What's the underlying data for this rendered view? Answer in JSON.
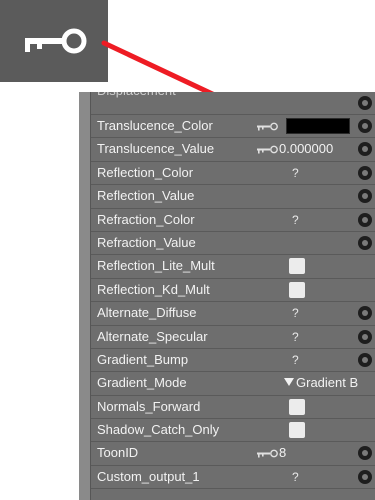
{
  "zoom_icon": {
    "name": "key-icon",
    "color": "#ffffff"
  },
  "arrow_color": "#ee1c24",
  "rows": [
    {
      "label": "Displacement",
      "partial": true
    },
    {
      "label": "Translucence_Color",
      "key": true,
      "swatch": "#000000",
      "radio": true
    },
    {
      "label": "Translucence_Value",
      "key": true,
      "value": "0.000000",
      "radio": true
    },
    {
      "label": "Reflection_Color",
      "question": "?",
      "radio": true
    },
    {
      "label": "Reflection_Value",
      "radio": true
    },
    {
      "label": "Refraction_Color",
      "question": "?",
      "radio": true
    },
    {
      "label": "Refraction_Value",
      "radio": true
    },
    {
      "label": "Reflection_Lite_Mult",
      "checkbox": true
    },
    {
      "label": "Reflection_Kd_Mult",
      "checkbox": true
    },
    {
      "label": "Alternate_Diffuse",
      "question": "?",
      "radio": true
    },
    {
      "label": "Alternate_Specular",
      "question": "?",
      "radio": true
    },
    {
      "label": "Gradient_Bump",
      "question": "?",
      "radio": true
    },
    {
      "label": "Gradient_Mode",
      "dropdown": "Gradient B"
    },
    {
      "label": "Normals_Forward",
      "checkbox": true
    },
    {
      "label": "Shadow_Catch_Only",
      "checkbox": true
    },
    {
      "label": "ToonID",
      "key": true,
      "value": "8",
      "radio": true
    },
    {
      "label": "Custom_output_1",
      "question": "?",
      "radio": true
    }
  ]
}
